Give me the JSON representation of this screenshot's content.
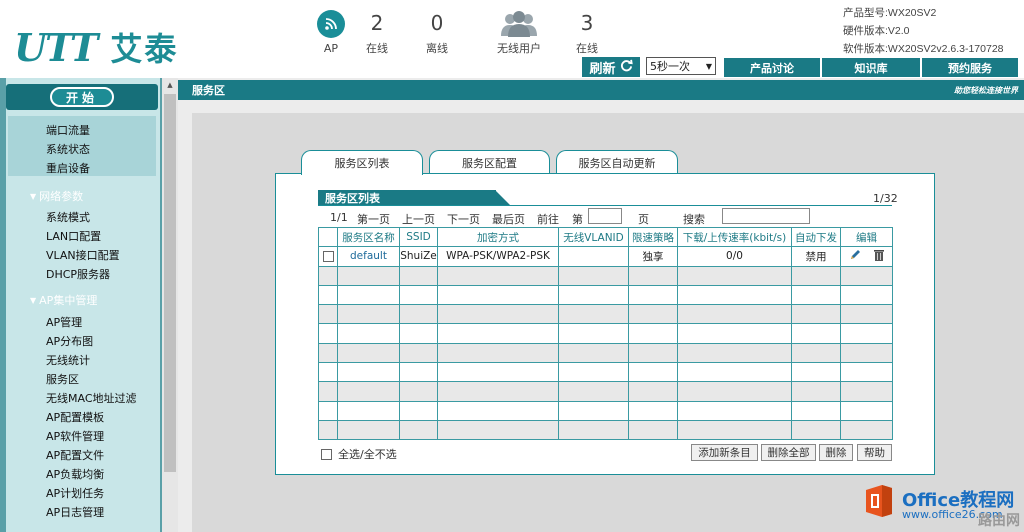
{
  "header": {
    "logo_latin": "UTT",
    "logo_cn": "艾泰",
    "stats": {
      "ap_label": "AP",
      "online_count": "2",
      "online_label": "在线",
      "offline_count": "0",
      "offline_label": "离线",
      "wireless_users_label": "无线用户",
      "users_online_count": "3",
      "users_online_label": "在线"
    },
    "info": {
      "product_model": "产品型号:WX20SV2",
      "hardware_version": "硬件版本:V2.0",
      "software_version": "软件版本:WX20SV2v2.6.3-170728"
    },
    "refresh_label": "刷新",
    "refresh_interval": "5秒一次",
    "nav": [
      "产品讨论",
      "知识库",
      "预约服务"
    ]
  },
  "sidebar": {
    "start_label": "开始",
    "quick_items": [
      "端口流量",
      "系统状态",
      "重启设备"
    ],
    "sections": [
      {
        "title": "网络参数",
        "items": [
          "系统模式",
          "LAN口配置",
          "VLAN接口配置",
          "DHCP服务器"
        ]
      },
      {
        "title": "AP集中管理",
        "items": [
          "AP管理",
          "AP分布图",
          "无线统计",
          "服务区",
          "无线MAC地址过滤",
          "AP配置模板",
          "AP软件管理",
          "AP配置文件",
          "AP负载均衡",
          "AP计划任务",
          "AP日志管理"
        ]
      }
    ]
  },
  "main": {
    "title": "服务区",
    "slogan": "助您轻松连接世界",
    "tabs": [
      "服务区列表",
      "服务区配置",
      "服务区自动更新"
    ],
    "list_title": "服务区列表",
    "page_count": "1/32",
    "pager": {
      "current": "1/1",
      "first": "第一页",
      "prev": "上一页",
      "next": "下一页",
      "last": "最后页",
      "goto": "前往",
      "page_prefix": "第",
      "page_suffix": "页",
      "search_label": "搜索"
    },
    "table": {
      "columns": [
        "服务区名称",
        "SSID",
        "加密方式",
        "无线VLANID",
        "限速策略",
        "下载/上传速率(kbit/s)",
        "自动下发",
        "编辑"
      ],
      "rows": [
        {
          "name": "default",
          "ssid": "ShuiZe",
          "encryption": "WPA-PSK/WPA2-PSK",
          "vlanid": "",
          "rate_policy": "独享",
          "rate": "0/0",
          "auto_issue": "禁用"
        }
      ]
    },
    "select_all_label": "全选/全不选",
    "buttons": {
      "add": "添加新条目",
      "delete_all": "删除全部",
      "delete": "删除",
      "help": "帮助"
    }
  },
  "watermark": {
    "brand": "Office教程网",
    "url": "www.office26.com",
    "corner": "路由网"
  },
  "colors": {
    "teal_dark": "#1a7a85",
    "teal": "#1a8e98",
    "sidebar_bg": "#c8e6e8"
  }
}
